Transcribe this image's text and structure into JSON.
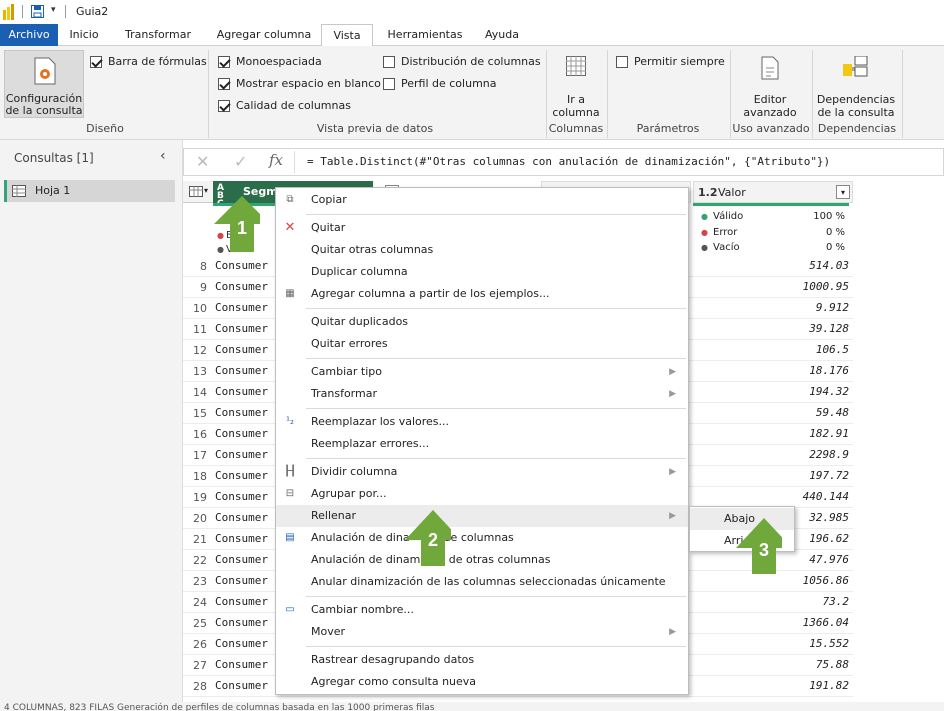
{
  "window": {
    "title": "Guia2"
  },
  "tabs": [
    "Archivo",
    "Inicio",
    "Transformar",
    "Agregar columna",
    "Vista",
    "Herramientas",
    "Ayuda"
  ],
  "ribbon": {
    "config_btn_line1": "Configuración",
    "config_btn_line2": "de la consulta",
    "barra_formulas": "Barra de fórmulas",
    "monoespaciada": "Monoespaciada",
    "mostrar_espacio": "Mostrar espacio en blanco",
    "calidad": "Calidad de columnas",
    "distribucion": "Distribución de columnas",
    "perfil": "Perfil de columna",
    "ir_line1": "Ir a",
    "ir_line2": "columna",
    "permitir": "Permitir siempre",
    "editor_line1": "Editor",
    "editor_line2": "avanzado",
    "dep_line1": "Dependencias",
    "dep_line2": "de la consulta",
    "groups": {
      "diseno": "Diseño",
      "vista_previa": "Vista previa de datos",
      "columnas": "Columnas",
      "parametros": "Parámetros",
      "uso_avanzado": "Uso avanzado",
      "dependencias": "Dependencias"
    }
  },
  "left": {
    "title": "Consultas [1]",
    "query": "Hoja 1"
  },
  "formula": {
    "text": "= Table.Distinct(#\"Otras columnas con anulación de dinamización\", {\"Atributo\"})"
  },
  "grid": {
    "col1_header": "Segmen",
    "col1_type": "A B C",
    "col4_header": "Valor",
    "col4_type": "1.2",
    "q1": {
      "valido": "Válido",
      "error": "Error",
      "vacio": "Vacío"
    },
    "q4": {
      "valido": "Válido",
      "valido_pct": "100 %",
      "error": "Error",
      "error_pct": "0 %",
      "vacio": "Vacío",
      "vacio_pct": "0 %"
    },
    "rows": [
      {
        "n": "8",
        "seg": "Consumer",
        "val": "514.03"
      },
      {
        "n": "9",
        "seg": "Consumer",
        "val": "1000.95"
      },
      {
        "n": "10",
        "seg": "Consumer",
        "val": "9.912"
      },
      {
        "n": "11",
        "seg": "Consumer",
        "val": "39.128"
      },
      {
        "n": "12",
        "seg": "Consumer",
        "val": "106.5"
      },
      {
        "n": "13",
        "seg": "Consumer",
        "val": "18.176"
      },
      {
        "n": "14",
        "seg": "Consumer",
        "val": "194.32"
      },
      {
        "n": "15",
        "seg": "Consumer",
        "val": "59.48"
      },
      {
        "n": "16",
        "seg": "Consumer",
        "val": "182.91"
      },
      {
        "n": "17",
        "seg": "Consumer",
        "val": "2298.9"
      },
      {
        "n": "18",
        "seg": "Consumer",
        "val": "197.72"
      },
      {
        "n": "19",
        "seg": "Consumer",
        "val": "440.144"
      },
      {
        "n": "20",
        "seg": "Consumer",
        "val": "32.985"
      },
      {
        "n": "21",
        "seg": "Consumer",
        "val": "196.62"
      },
      {
        "n": "22",
        "seg": "Consumer",
        "val": "47.976"
      },
      {
        "n": "23",
        "seg": "Consumer",
        "val": "1056.86"
      },
      {
        "n": "24",
        "seg": "Consumer",
        "val": "73.2"
      },
      {
        "n": "25",
        "seg": "Consumer",
        "val": "1366.04"
      },
      {
        "n": "26",
        "seg": "Consumer",
        "val": "15.552"
      },
      {
        "n": "27",
        "seg": "Consumer",
        "val": "75.88"
      },
      {
        "n": "28",
        "seg": "Consumer",
        "val": "191.82"
      }
    ]
  },
  "menu": {
    "copiar": "Copiar",
    "quitar": "Quitar",
    "quitar_otras": "Quitar otras columnas",
    "duplicar": "Duplicar columna",
    "agregar_ejemplos": "Agregar columna a partir de los ejemplos...",
    "quitar_dup": "Quitar duplicados",
    "quitar_err": "Quitar errores",
    "cambiar_tipo": "Cambiar tipo",
    "transformar": "Transformar",
    "reemplazar_valores": "Reemplazar los valores...",
    "reemplazar_errores": "Reemplazar errores...",
    "dividir": "Dividir columna",
    "agrupar": "Agrupar por...",
    "rellenar": "Rellenar",
    "anulacion_cols_a": "Anulación de dina",
    "anulacion_cols_b": "de columnas",
    "anulacion_otras_a": "Anulación de dinam",
    "anulacion_otras_b": "n de otras columnas",
    "anular_sel": "Anular dinamización de las columnas seleccionadas únicamente",
    "cambiar_nombre": "Cambiar nombre...",
    "mover": "Mover",
    "rastrear": "Rastrear desagrupando datos",
    "agregar_consulta": "Agregar como consulta nueva"
  },
  "submenu": {
    "abajo": "Abajo",
    "arriba": "Arri"
  },
  "callouts": [
    "1",
    "2",
    "3"
  ],
  "status": {
    "text": "4 COLUMNAS, 823 FILAS    Generación de perfiles de columnas basada en las 1000 primeras filas"
  },
  "colors": {
    "accent_green": "#70a83c",
    "file_tab": "#1a5fb4",
    "query_bar": "#33a37a"
  }
}
